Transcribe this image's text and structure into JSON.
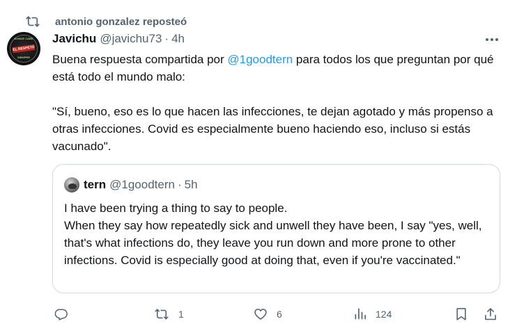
{
  "repost_context": {
    "text": "antonio gonzalez reposteó",
    "icon": "repost-icon"
  },
  "tweet": {
    "author_name": "Javichu",
    "author_handle": "@javichu73",
    "separator": "·",
    "time": "4h",
    "avatar_text": {
      "top": "DONDE CABE",
      "band": "EL RESPETO",
      "bottom": "SIEMPRE"
    },
    "text": {
      "line1_before": "Buena respuesta compartida por ",
      "mention": "@1goodtern",
      "line1_after": " para todos los que preguntan por qué está todo el mundo malo:",
      "paragraph2": "\"Sí, bueno, eso es lo que hacen las infecciones, te dejan agotado y más propenso a otras infecciones. Covid es especialmente bueno haciendo eso, incluso si estás vacunado\"."
    }
  },
  "quote": {
    "author_name": "tern",
    "author_handle": "@1goodtern",
    "separator": "·",
    "time": "5h",
    "line1": "I have been trying a thing to say to people.",
    "line2": "When they say how repeatedly sick and unwell they have been, I say \"yes, well, that's what infections do, they leave you run down and more prone to other infections. Covid is especially good at doing that, even if you're vaccinated.\""
  },
  "actions": {
    "reply": {
      "icon": "reply-icon",
      "count": ""
    },
    "repost": {
      "icon": "repost-icon",
      "count": "1"
    },
    "like": {
      "icon": "heart-icon",
      "count": "6"
    },
    "views": {
      "icon": "views-chart-icon",
      "count": "124"
    },
    "bookmark": {
      "icon": "bookmark-icon"
    },
    "share": {
      "icon": "share-icon"
    }
  },
  "colors": {
    "text_primary": "#0f1419",
    "text_secondary": "#536471",
    "link": "#1d9bf0",
    "border": "#cfd9de"
  }
}
